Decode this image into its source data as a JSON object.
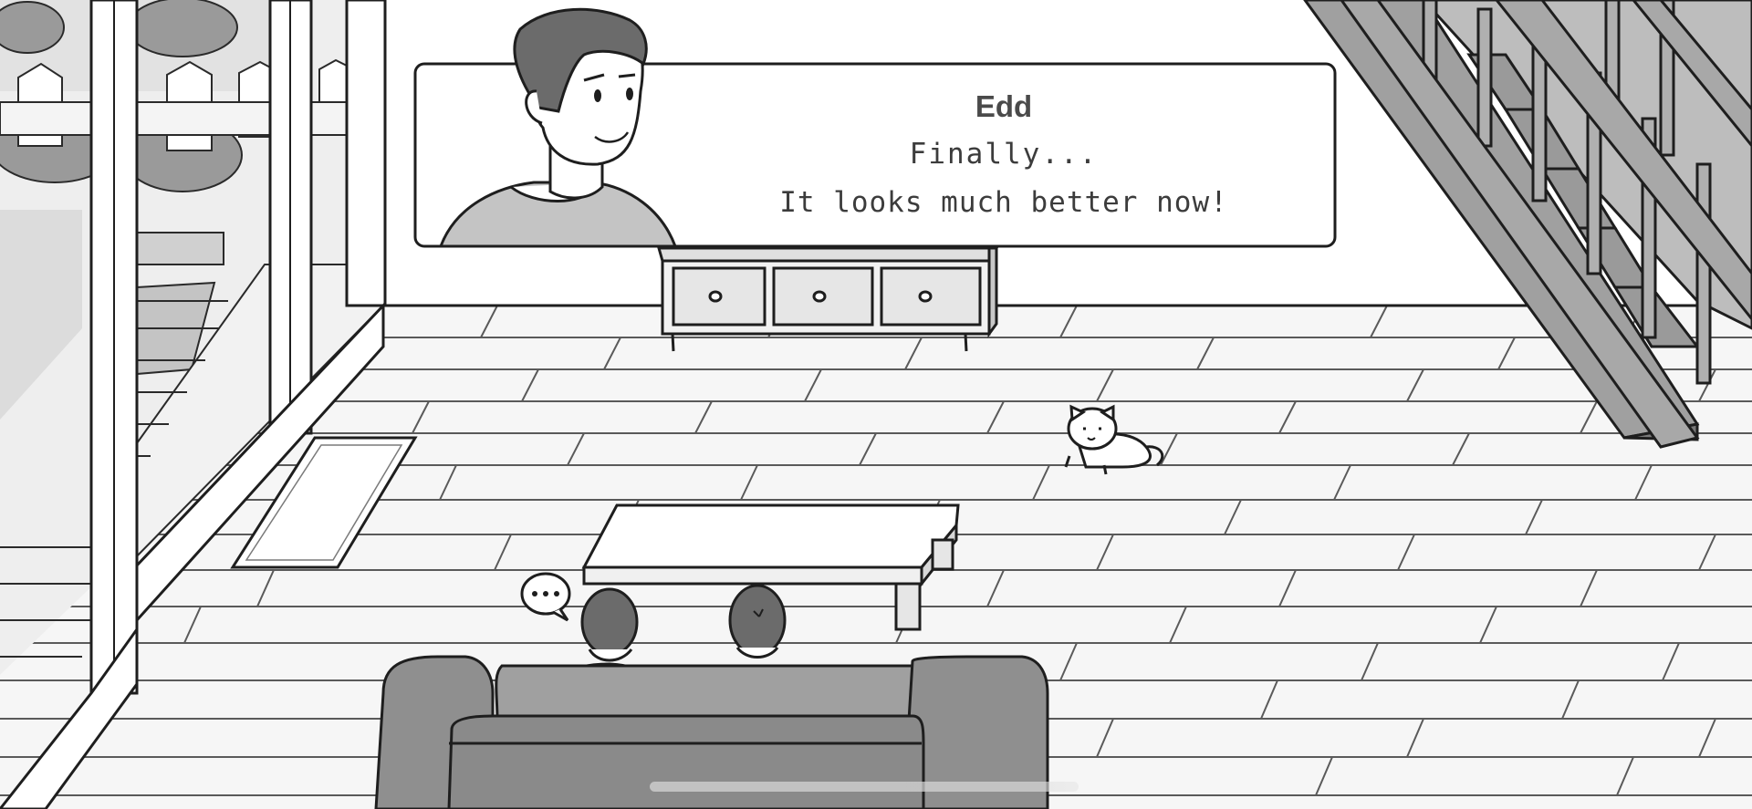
{
  "dialog": {
    "speaker": "Edd",
    "lines": [
      "Finally...",
      "It looks much better now!"
    ]
  },
  "icons": {
    "speech_bubble": "speech-bubble-ellipsis-icon"
  },
  "colors": {
    "outline": "#1e1e1e",
    "floor": "#f6f6f6",
    "sofa": "#8f8f8f",
    "character_shirt": "#c8c8c8",
    "hair": "#6b6b6b"
  }
}
